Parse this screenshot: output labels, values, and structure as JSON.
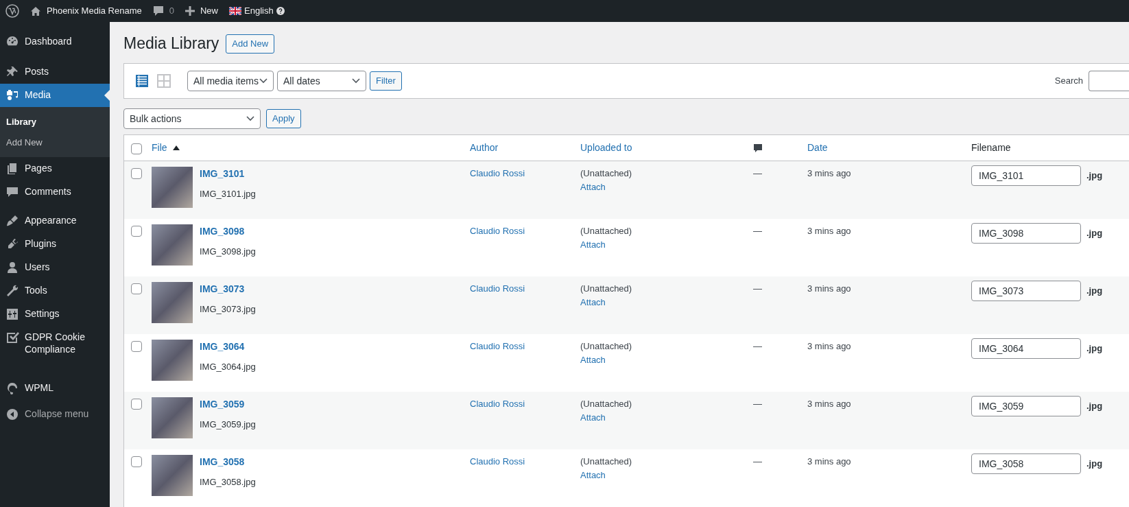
{
  "admin_bar": {
    "site_name": "Phoenix Media Rename",
    "comments_count": "0",
    "new_label": "New",
    "language": "English"
  },
  "sidebar": {
    "groups": [
      [
        {
          "label": "Dashboard",
          "selected": false
        }
      ],
      [
        {
          "label": "Posts",
          "selected": false
        },
        {
          "label": "Media",
          "selected": true,
          "children": [
            {
              "label": "Library",
              "selected": true
            },
            {
              "label": "Add New",
              "selected": false
            }
          ]
        },
        {
          "label": "Pages",
          "selected": false
        },
        {
          "label": "Comments",
          "selected": false
        }
      ],
      [
        {
          "label": "Appearance",
          "selected": false
        },
        {
          "label": "Plugins",
          "selected": false
        },
        {
          "label": "Users",
          "selected": false
        },
        {
          "label": "Tools",
          "selected": false
        },
        {
          "label": "Settings",
          "selected": false
        },
        {
          "label": "GDPR Cookie Compliance",
          "selected": false
        }
      ],
      [
        {
          "label": "WPML",
          "selected": false
        }
      ]
    ],
    "collapse_label": "Collapse menu"
  },
  "page": {
    "title": "Media Library",
    "add_new": "Add New"
  },
  "filter_bar": {
    "views": [
      {
        "kind": "list",
        "selected": true
      },
      {
        "kind": "grid",
        "selected": false
      }
    ],
    "type_filter": "All media items",
    "date_filter": "All dates",
    "filter_button": "Filter",
    "search_label": "Search"
  },
  "bulk": {
    "action": "Bulk actions",
    "apply": "Apply"
  },
  "table": {
    "all_checked": false,
    "columns": [
      {
        "label": "File",
        "sortable": true,
        "sorted": true
      },
      {
        "label": "Author",
        "sortable": true
      },
      {
        "label": "Uploaded to",
        "sortable": true
      },
      {
        "kind": "comments",
        "sortable": false
      },
      {
        "label": "Date",
        "sortable": true
      },
      {
        "label": "Filename",
        "sortable": false
      }
    ],
    "rows": [
      {
        "checked": false,
        "title": "IMG_3101",
        "file": "IMG_3101.jpg",
        "author": "Claudio Rossi",
        "uploaded_to": "(Unattached)",
        "attach": "Attach",
        "comments": "—",
        "date": "3 mins ago",
        "name": "IMG_3101",
        "ext": ".jpg"
      },
      {
        "checked": false,
        "title": "IMG_3098",
        "file": "IMG_3098.jpg",
        "author": "Claudio Rossi",
        "uploaded_to": "(Unattached)",
        "attach": "Attach",
        "comments": "—",
        "date": "3 mins ago",
        "name": "IMG_3098",
        "ext": ".jpg"
      },
      {
        "checked": false,
        "title": "IMG_3073",
        "file": "IMG_3073.jpg",
        "author": "Claudio Rossi",
        "uploaded_to": "(Unattached)",
        "attach": "Attach",
        "comments": "—",
        "date": "3 mins ago",
        "name": "IMG_3073",
        "ext": ".jpg"
      },
      {
        "checked": false,
        "title": "IMG_3064",
        "file": "IMG_3064.jpg",
        "author": "Claudio Rossi",
        "uploaded_to": "(Unattached)",
        "attach": "Attach",
        "comments": "—",
        "date": "3 mins ago",
        "name": "IMG_3064",
        "ext": ".jpg"
      },
      {
        "checked": false,
        "title": "IMG_3059",
        "file": "IMG_3059.jpg",
        "author": "Claudio Rossi",
        "uploaded_to": "(Unattached)",
        "attach": "Attach",
        "comments": "—",
        "date": "3 mins ago",
        "name": "IMG_3059",
        "ext": ".jpg"
      },
      {
        "checked": false,
        "title": "IMG_3058",
        "file": "IMG_3058.jpg",
        "author": "Claudio Rossi",
        "uploaded_to": "(Unattached)",
        "attach": "Attach",
        "comments": "—",
        "date": "3 mins ago",
        "name": "IMG_3058",
        "ext": ".jpg"
      }
    ]
  }
}
